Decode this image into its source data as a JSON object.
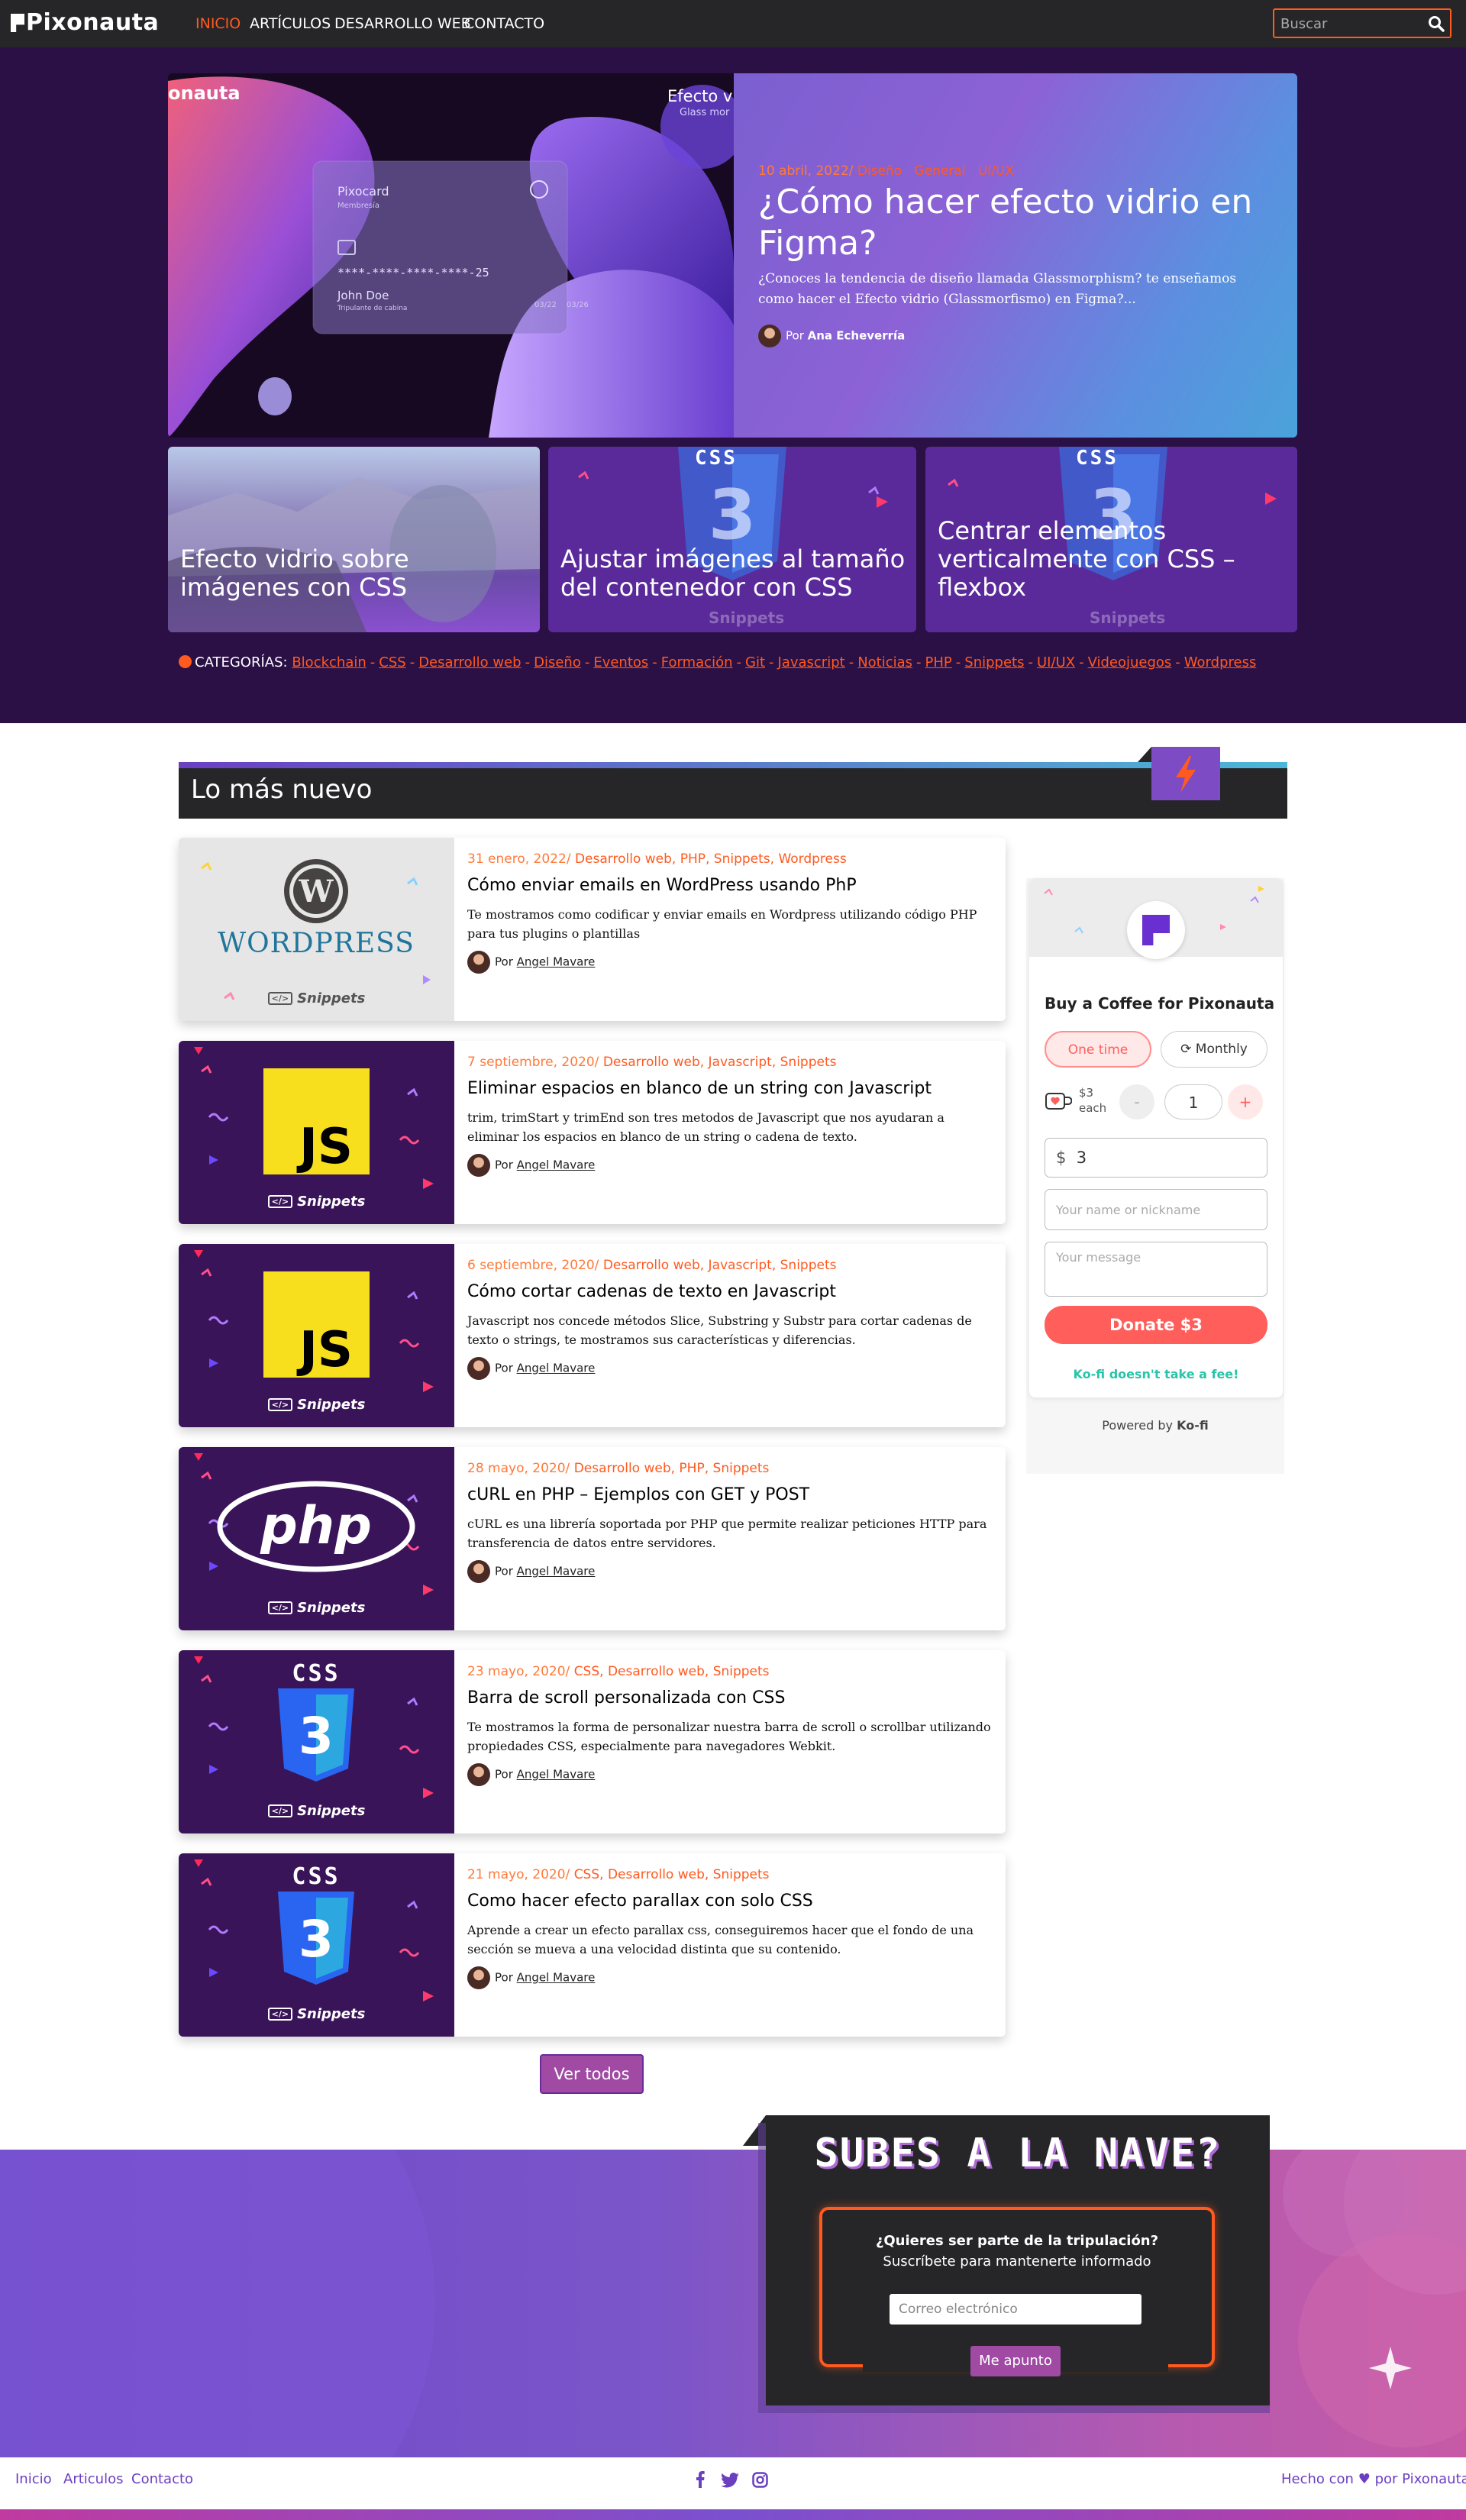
{
  "nav": {
    "logo": "Pixonauta",
    "links": [
      "INICIO",
      "ARTÍCULOS",
      "DESARROLLO WEB",
      "CONTACTO"
    ],
    "search_placeholder": "Buscar"
  },
  "featured": {
    "image_texts": {
      "brand": "onauta",
      "tag": "Efecto  v",
      "tag2": "Glass mor",
      "card_name": "Pixocard",
      "card_sub": "Membresía",
      "card_number": "****-****-****-****-25",
      "holder": "John Doe",
      "holder_sub": "Tripulante de cabina",
      "date1": "03/22",
      "date2": "03/26"
    },
    "date": "10 abril, 2022/",
    "categories": [
      "Diseño",
      "General",
      "UI/UX"
    ],
    "title": "¿Cómo hacer efecto vidrio en Figma?",
    "excerpt": "¿Conoces la tendencia de diseño llamada Glassmorphism? te enseñamos como hacer el Efecto vidrio (Glassmorfismo) en Figma?...",
    "by": "Por",
    "author": "Ana Echeverría"
  },
  "small_cards": [
    {
      "title": "Efecto vidrio sobre imágenes con CSS"
    },
    {
      "title": "Ajustar imágenes al tamaño del contenedor con CSS",
      "badge": "CSS",
      "watermark": "Snippets"
    },
    {
      "title": "Centrar elementos verticalmente con CSS – flexbox",
      "badge": "CSS",
      "watermark": "Snippets"
    }
  ],
  "categories": {
    "label": "CATEGORÍAS:",
    "items": [
      "Blockchain",
      "CSS",
      "Desarrollo web",
      "Diseño",
      "Eventos",
      "Formación",
      "Git",
      "Javascript",
      "Noticias",
      "PHP",
      "Snippets",
      "UI/UX",
      "Videojuegos",
      "Wordpress"
    ]
  },
  "newest": {
    "title": "Lo más nuevo",
    "snippets_label": "Snippets",
    "posts": [
      {
        "thumb": "wordpress",
        "date": "31 enero, 2022/",
        "cats": "Desarrollo web, PHP, Snippets, Wordpress",
        "title": "Cómo enviar emails en WordPress usando PhP",
        "excerpt": "Te mostramos como codificar y enviar emails en Wordpress utilizando código PHP para tus plugins o plantillas",
        "by": "Por",
        "author": "Angel Mavare"
      },
      {
        "thumb": "js",
        "date": "7 septiembre, 2020/",
        "cats": "Desarrollo web, Javascript, Snippets",
        "title": "Eliminar espacios en blanco de un string con Javascript",
        "excerpt": "trim, trimStart y trimEnd son tres metodos de Javascript que nos ayudaran a eliminar los espacios en blanco de un string o cadena de texto.",
        "by": "Por",
        "author": "Angel Mavare"
      },
      {
        "thumb": "js",
        "date": "6 septiembre, 2020/",
        "cats": "Desarrollo web, Javascript, Snippets",
        "title": "Cómo cortar cadenas de texto en Javascript",
        "excerpt": "Javascript nos concede métodos Slice, Substring y Substr para cortar cadenas de texto o strings, te mostramos sus características y diferencias.",
        "by": "Por",
        "author": "Angel Mavare"
      },
      {
        "thumb": "php",
        "date": "28 mayo, 2020/",
        "cats": "Desarrollo web, PHP, Snippets",
        "title": "cURL en PHP – Ejemplos con GET y POST",
        "excerpt": "cURL es una librería soportada por PHP que permite realizar peticiones HTTP para transferencia de datos entre servidores.",
        "by": "Por",
        "author": "Angel Mavare"
      },
      {
        "thumb": "css",
        "date": "23 mayo, 2020/",
        "cats": "CSS, Desarrollo web, Snippets",
        "title": "Barra de scroll personalizada con CSS",
        "excerpt": "Te mostramos la forma de personalizar nuestra barra de scroll o scrollbar utilizando propiedades CSS, especialmente para navegadores Webkit.",
        "by": "Por",
        "author": "Angel Mavare"
      },
      {
        "thumb": "css",
        "date": "21 mayo, 2020/",
        "cats": "CSS, Desarrollo web, Snippets",
        "title": "Como hacer efecto parallax con solo CSS",
        "excerpt": "Aprende a crear un efecto parallax css, conseguiremos hacer que el fondo de una sección se mueva a una velocidad distinta que su contenido.",
        "by": "Por",
        "author": "Angel Mavare"
      }
    ],
    "view_all": "Ver todos"
  },
  "kofi": {
    "title": "Buy a Coffee for Pixonauta",
    "one_time": "One time",
    "monthly": "Monthly",
    "price": "$3",
    "each": "each",
    "minus": "-",
    "quantity": "1",
    "plus": "+",
    "currency": "$",
    "amount": "3",
    "name_placeholder": "Your name or nickname",
    "message_placeholder": "Your message",
    "donate": "Donate $3",
    "fee_note": "Ko-fi doesn't take a fee!",
    "powered_by": "Powered by",
    "powered_brand": "Ko-fi"
  },
  "newsletter": {
    "title": "SUBES A LA NAVE?",
    "heading": "¿Quieres ser parte de la tripulación?",
    "sub": "Suscríbete para mantenerte informado",
    "email_placeholder": "Correo electrónico",
    "button": "Me apunto"
  },
  "footer": {
    "links": [
      "Inicio",
      "Articulos",
      "Contacto"
    ],
    "made_with": "Hecho con",
    "by": "por",
    "brand": "Pixonauta"
  },
  "colors": {
    "accent": "#ff5a1f",
    "purple": "#7d4bc3",
    "nav_bg": "#262628",
    "kofi_red": "#ff5e5b",
    "kofi_green": "#29c4a9"
  }
}
